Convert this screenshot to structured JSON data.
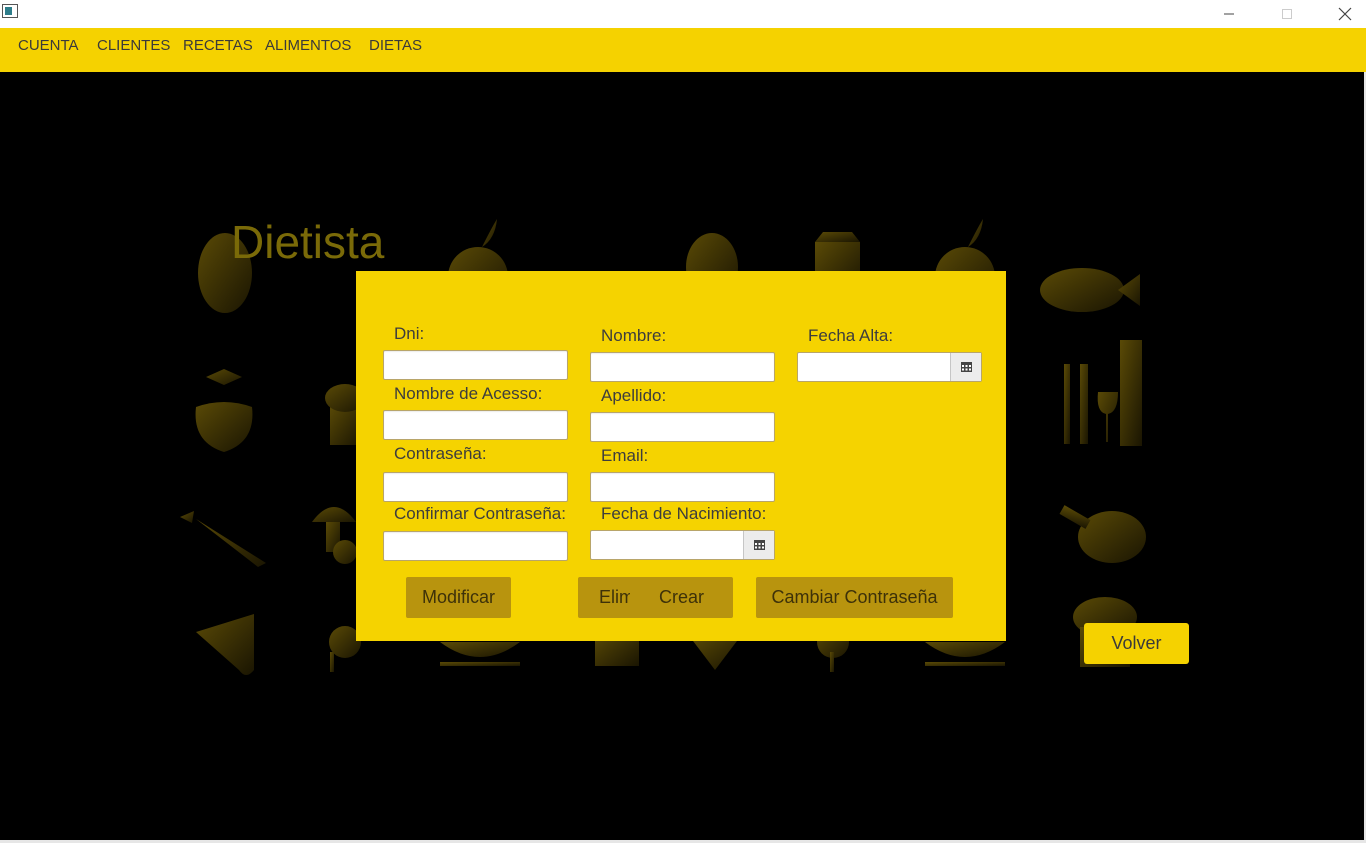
{
  "window": {
    "minimize_glyph": "—",
    "maximize_glyph": "☐",
    "close_glyph": "✕"
  },
  "menu": {
    "items": [
      "CUENTA",
      "CLIENTES",
      "RECETAS",
      "ALIMENTOS",
      "DIETAS"
    ]
  },
  "background": {
    "title": "Dietista",
    "icons": [
      "egg-icon",
      "apple-icon",
      "potato-icon",
      "milk-carton-icon",
      "apple-icon",
      "fish-icon",
      "strawberry-icon",
      "cupcake-icon",
      "cutlery-wine-icon",
      "carrot-icon",
      "mushroom-icon",
      "chicken-leg-icon",
      "cheese-icon",
      "parsley-icon",
      "soup-bowl-icon",
      "mug-icon",
      "pizza-slice-icon",
      "muffin-icon"
    ]
  },
  "form": {
    "labels": {
      "dni": "Dni:",
      "nombre_acceso": "Nombre de Acesso:",
      "contrasena": "Contraseña:",
      "confirmar": "Confirmar Contraseña:",
      "nombre": "Nombre:",
      "apellido": "Apellido:",
      "email": "Email:",
      "fecha_nacimiento": "Fecha de Nacimiento:",
      "fecha_alta": "Fecha Alta:"
    },
    "values": {
      "dni": "",
      "nombre_acceso": "",
      "contrasena": "",
      "confirmar": "",
      "nombre": "",
      "apellido": "",
      "email": "",
      "fecha_nacimiento": "",
      "fecha_alta": ""
    },
    "buttons": {
      "modificar": "Modificar",
      "eliminar": "Elim",
      "crear": "Crear",
      "cambiar": "Cambiar Contraseña"
    }
  },
  "volver_label": "Volver",
  "colors": {
    "accent": "#f5d200",
    "button": "#b8940e",
    "background": "#000000"
  }
}
